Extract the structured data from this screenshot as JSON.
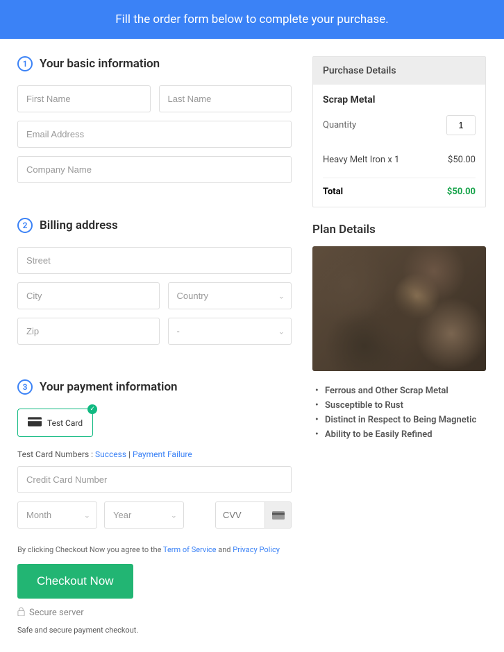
{
  "header": {
    "banner": "Fill the order form below to complete your purchase."
  },
  "steps": {
    "s1": {
      "num": "1",
      "title": "Your basic information"
    },
    "s2": {
      "num": "2",
      "title": "Billing address"
    },
    "s3": {
      "num": "3",
      "title": "Your payment information"
    }
  },
  "basic": {
    "first_name_ph": "First Name",
    "last_name_ph": "Last Name",
    "email_ph": "Email Address",
    "company_ph": "Company Name"
  },
  "billing": {
    "street_ph": "Street",
    "city_ph": "City",
    "country_ph": "Country",
    "zip_ph": "Zip",
    "state_ph": "-"
  },
  "payment": {
    "card_option_label": "Test  Card",
    "test_line_prefix": "Test Card Numbers : ",
    "success_link": "Success",
    "separator": " | ",
    "failure_link": "Payment Failure",
    "cc_ph": "Credit Card Number",
    "month_ph": "Month",
    "year_ph": "Year",
    "cvv_ph": "CVV"
  },
  "terms": {
    "prefix": "By clicking Checkout Now you agree to the ",
    "tos": "Term of Service",
    "and": " and ",
    "pp": "Privacy Policy"
  },
  "checkout_btn": "Checkout Now",
  "secure_server": "Secure server",
  "safe_text": "Safe and secure payment checkout.",
  "purchase": {
    "header": "Purchase Details",
    "product": "Scrap Metal",
    "qty_label": "Quantity",
    "qty_value": "1",
    "line_label": "Heavy Melt Iron x 1",
    "line_amount": "$50.00",
    "total_label": "Total",
    "total_amount": "$50.00"
  },
  "plan": {
    "title": "Plan Details",
    "bullets": [
      "Ferrous and Other Scrap Metal",
      "Susceptible to Rust",
      "Distinct in Respect to Being Magnetic",
      "Ability to be Easily Refined"
    ]
  }
}
